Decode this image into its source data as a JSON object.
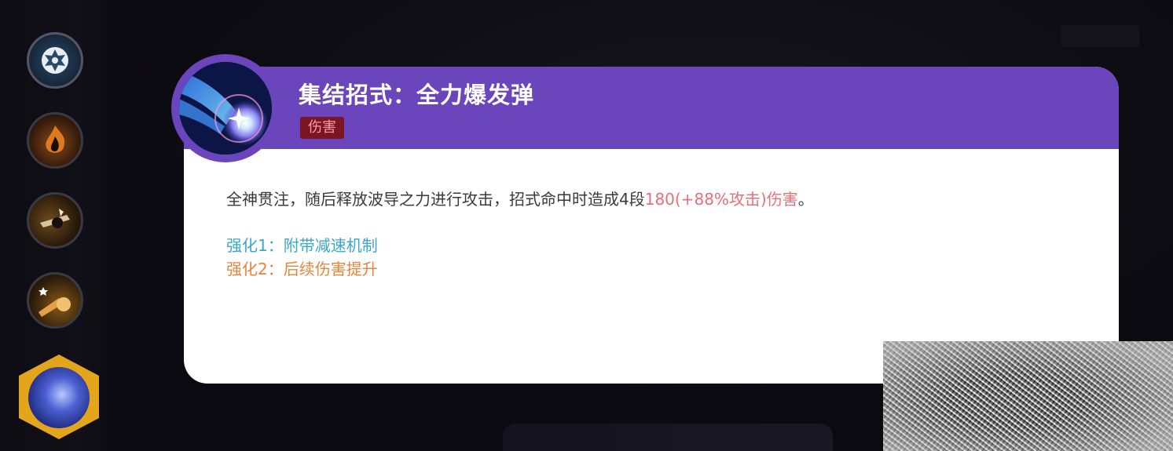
{
  "skill_card": {
    "title": "集结招式：全力爆发弹",
    "tag": "伤害",
    "description_prefix": "全神贯注，随后释放波导之力进行攻击，招式命中时造成4段",
    "description_damage": "180(+88%攻击)伤害",
    "description_suffix": "。",
    "enhancements": [
      {
        "label": "强化1：附带减速机制",
        "color": "#3aa8c8"
      },
      {
        "label": "强化2：后续伤害提升",
        "color": "#e8843a"
      }
    ]
  },
  "colors": {
    "header": "#6a45bc",
    "tag_bg": "#7a1624",
    "damage_text": "#e5707a"
  },
  "sidebar": {
    "slots": [
      {
        "icon": "gear-skill-icon"
      },
      {
        "icon": "fire-skill-icon"
      },
      {
        "icon": "strike-skill-icon"
      },
      {
        "icon": "punch-skill-icon"
      },
      {
        "icon": "aura-sphere-unite-icon"
      }
    ]
  }
}
